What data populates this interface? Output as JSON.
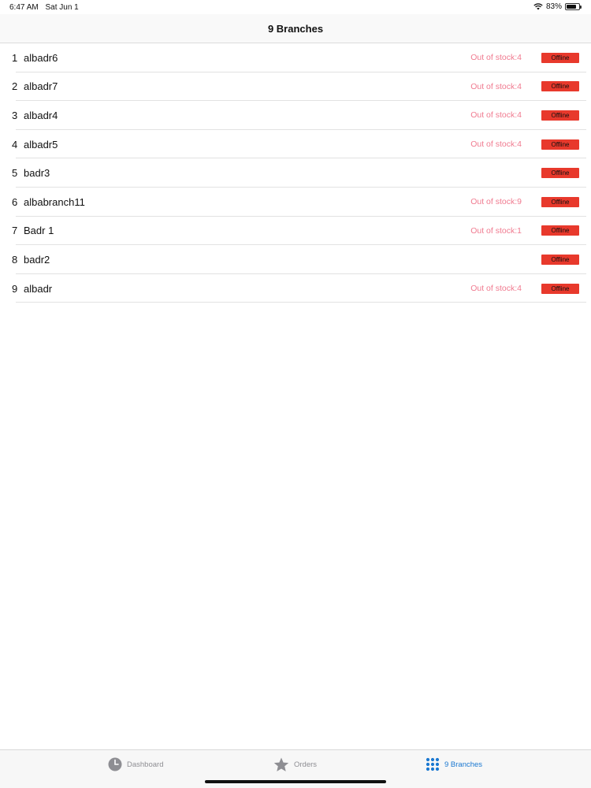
{
  "status_bar": {
    "time": "6:47 AM",
    "date": "Sat Jun 1",
    "battery": "83%",
    "battery_level": 0.83
  },
  "nav": {
    "title": "9 Branches"
  },
  "branches": [
    {
      "index": "1",
      "name": "albadr6",
      "stock": "Out of stock:4",
      "status": "Offline"
    },
    {
      "index": "2",
      "name": "albadr7",
      "stock": "Out of stock:4",
      "status": "Offline"
    },
    {
      "index": "3",
      "name": "albadr4",
      "stock": "Out of stock:4",
      "status": "Offline"
    },
    {
      "index": "4",
      "name": "albadr5",
      "stock": "Out of stock:4",
      "status": "Offline"
    },
    {
      "index": "5",
      "name": "badr3",
      "stock": "",
      "status": "Offline"
    },
    {
      "index": "6",
      "name": "albabranch11",
      "stock": "Out of stock:9",
      "status": "Offline"
    },
    {
      "index": "7",
      "name": "Badr 1",
      "stock": "Out of stock:1",
      "status": "Offline"
    },
    {
      "index": "8",
      "name": "badr2",
      "stock": "",
      "status": "Offline"
    },
    {
      "index": "9",
      "name": "albadr",
      "stock": "Out of stock:4",
      "status": "Offline"
    }
  ],
  "tabs": {
    "dashboard": {
      "label": "Dashboard",
      "icon": "clock-icon"
    },
    "orders": {
      "label": "Orders",
      "icon": "star-icon"
    },
    "branches": {
      "label": "9 Branches",
      "icon": "grid-icon"
    }
  },
  "colors": {
    "accent": "#1a78d1",
    "offline": "#e8392c",
    "stock_text": "#f07a8f",
    "inactive_tab": "#8e8e93"
  }
}
